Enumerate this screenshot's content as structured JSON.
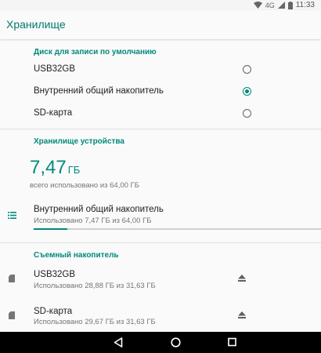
{
  "status_bar": {
    "network": "4G",
    "time": "11:33"
  },
  "app_bar": {
    "title": "Хранилище"
  },
  "default_write_disk": {
    "header": "Диск для записи по умолчанию",
    "options": [
      {
        "label": "USB32GB",
        "selected": false
      },
      {
        "label": "Внутренний общий накопитель",
        "selected": true
      },
      {
        "label": "SD-карта",
        "selected": false
      }
    ]
  },
  "device_storage": {
    "header": "Хранилище устройства",
    "used_value": "7,47",
    "used_unit": "ГБ",
    "used_caption": "всего использовано из 64,00 ГБ",
    "item": {
      "label": "Внутренний общий накопитель",
      "sub": "Использовано 7,47 ГБ из 64,00 ГБ",
      "used_fraction": 0.1167,
      "icon": "storage-list-icon"
    }
  },
  "removable_storage": {
    "header": "Съемный накопитель",
    "items": [
      {
        "label": "USB32GB",
        "sub": "Использовано 28,88 ГБ из 31,63 ГБ",
        "icon": "sd-card-icon",
        "action_icon": "eject-icon"
      },
      {
        "label": "SD-карта",
        "sub": "Использовано 29,67 ГБ из 31,63 ГБ",
        "icon": "sd-card-icon",
        "action_icon": "eject-icon"
      }
    ]
  },
  "nav_bar": {
    "buttons": [
      "back-icon",
      "home-icon",
      "recents-icon"
    ]
  },
  "colors": {
    "accent": "#00897b",
    "title": "#00796b",
    "background": "#fafafa",
    "nav_bar": "#000000"
  }
}
